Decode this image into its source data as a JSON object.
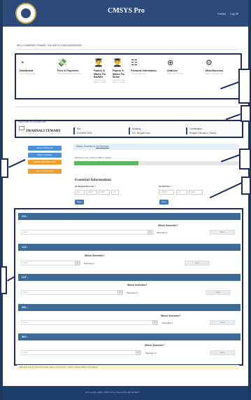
{
  "app": {
    "title": "CMSYS Pro",
    "links": [
      "Contact",
      "Log Off"
    ]
  },
  "welcome_line": "HELLO SWARNALI TEWARY. YOU ARE IN YOUR DASHBOARD",
  "menu": [
    {
      "icon": "speedometer-icon",
      "glyph": "◔",
      "title": "Dashboard",
      "sub": "Your landing Page"
    },
    {
      "icon": "money-icon",
      "glyph": "💸",
      "title": "Fees & Payments",
      "sub": "Outstanding fees, View fees"
    },
    {
      "icon": "student-icon",
      "glyph": "👨‍🎓",
      "title": "Papers & Marks For BA/BSc",
      "sub": "Semester-wise papers, marks"
    },
    {
      "icon": "student-icon",
      "glyph": "👨‍🎓",
      "title": "Papers & Marks For Bcom",
      "sub": "Semester-wise papers, marks"
    },
    {
      "icon": "person-list-icon",
      "glyph": "☷",
      "title": "Personal Information",
      "sub": "Your detailed info"
    },
    {
      "icon": "globe-icon",
      "glyph": "⊕",
      "title": "Address",
      "sub": "Where do you live?"
    },
    {
      "icon": "gears-icon",
      "glyph": "⚙",
      "title": "Miscellaneous",
      "sub": "Other important info"
    }
  ],
  "welcome_dashboard": "WELCOME TO DASHBOARD",
  "student": {
    "name": "SWARNALI TEWARY",
    "info": [
      {
        "label": "Roll",
        "value": "B-5465/570000"
      },
      {
        "label": "Studying",
        "value": "B.A. Bengali Hons"
      },
      {
        "label": "Combination",
        "value": "Bengali, Education, History"
      }
    ]
  },
  "side_buttons": [
    "Fees & Payments",
    "Papers & Marks",
    "Update Sem Pass Year",
    "Sem 1 Subscribe"
  ],
  "status": {
    "text": "Status: Currently in",
    "link": "3rd Semester"
  },
  "progress": {
    "label": "Welcome! Your profile is 39% complete",
    "percent": 39
  },
  "essential": {
    "title": "Essential Information:",
    "cu_reg_label": "CU Registration No. *",
    "cu_roll_label": "CU Roll No. *",
    "reg_fields": [
      "004",
      "2018",
      "0000",
      "18"
    ],
    "roll_fields": [
      "213404",
      "07",
      "0000"
    ],
    "save": "Save"
  },
  "semesters": [
    {
      "head": "CC1 :",
      "question": "Which Semester?",
      "placeholder": "Paper",
      "value": "Semester 1",
      "save": "Save"
    },
    {
      "head": "CC2 :",
      "question": "Which Semester?",
      "placeholder": "Paper",
      "value": "Semester 1",
      "save": "Save"
    },
    {
      "head": "CC7 :",
      "question": "Which Semester?",
      "placeholder": "Paper",
      "value": "Semester 2",
      "save": "Save"
    },
    {
      "head": "GE1 :",
      "question": "Which Semester?",
      "placeholder": "Paper",
      "value": "Semester 1",
      "save": "Save"
    },
    {
      "head": "SEC :",
      "question": "Which Semester?",
      "placeholder": "Paper",
      "value": "Semester 3",
      "save": "Save"
    }
  ],
  "warning": "Warning! If any of the information above is incorrect, contact College Office immediately.",
  "footer": "All Copyright 2020 | CMSYS Pro | Powered by ARI SOCIETY"
}
